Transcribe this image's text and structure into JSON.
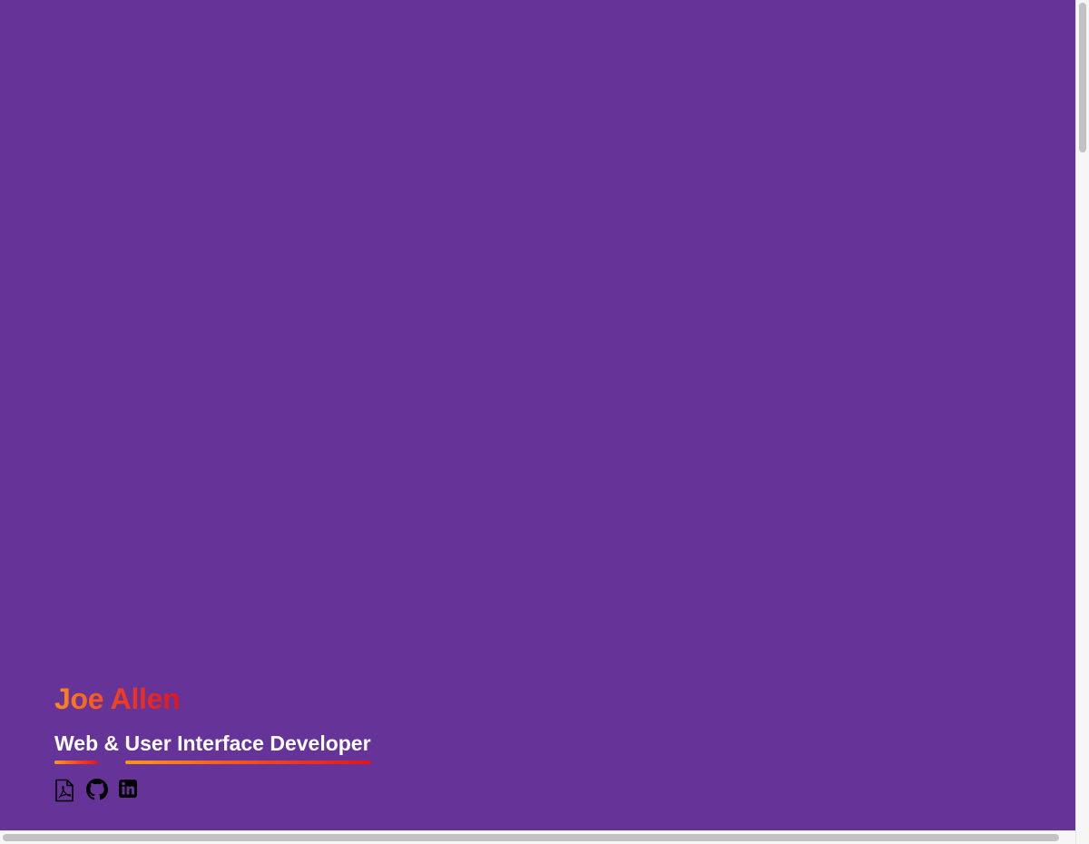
{
  "hero": {
    "name": "Joe Allen",
    "subtitle_part1": "Web",
    "subtitle_sep": " & ",
    "subtitle_part2": "User Interface Developer"
  },
  "links": [
    {
      "icon": "pdf-resume-icon",
      "label": "Resume PDF"
    },
    {
      "icon": "github-icon",
      "label": "GitHub"
    },
    {
      "icon": "linkedin-icon",
      "label": "LinkedIn"
    }
  ],
  "colors": {
    "background": "#663399",
    "gradient_start": "#ff8c1a",
    "gradient_end": "#e0161e",
    "subtitle_text": "#ffffff",
    "icon": "#000000"
  }
}
